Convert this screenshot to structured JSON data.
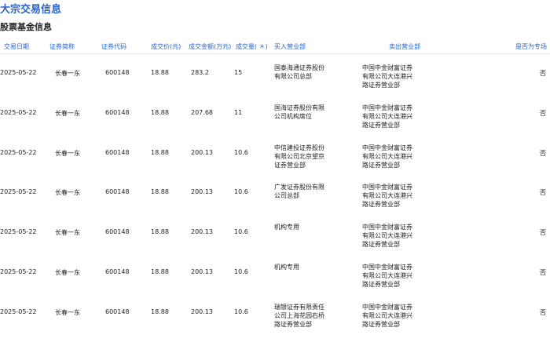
{
  "page": {
    "title": "大宗交易信息",
    "section_title": "股票基金信息"
  },
  "table": {
    "headers": [
      "交易日期",
      "证券简称",
      "证券代码",
      "成交价(元)",
      "成交金额(万元)",
      "成交量( ＊)",
      "买入营业部",
      "卖出营业部",
      "是否为专场"
    ],
    "rows": [
      {
        "date": "2025-05-22",
        "name": "长春一东",
        "code": "600148",
        "price": "18.88",
        "amount": "283.2",
        "volume": "15",
        "buyer": [
          "国泰海通证券股份",
          "有限公司总部"
        ],
        "seller": [
          "中国中金财富证券",
          "有限公司大连港兴",
          "路证券营业部"
        ],
        "special": "否"
      },
      {
        "date": "2025-05-22",
        "name": "长春一东",
        "code": "600148",
        "price": "18.88",
        "amount": "207.68",
        "volume": "11",
        "buyer": [
          "国海证券股份有限",
          "公司机构席位"
        ],
        "seller": [
          "中国中金财富证券",
          "有限公司大连港兴",
          "路证券营业部"
        ],
        "special": "否"
      },
      {
        "date": "2025-05-22",
        "name": "长春一东",
        "code": "600148",
        "price": "18.88",
        "amount": "200.13",
        "volume": "10.6",
        "buyer": [
          "中信建投证券股份",
          "有限公司北京望京",
          "证券营业部"
        ],
        "seller": [
          "中国中金财富证券",
          "有限公司大连港兴",
          "路证券营业部"
        ],
        "special": "否"
      },
      {
        "date": "2025-05-22",
        "name": "长春一东",
        "code": "600148",
        "price": "18.88",
        "amount": "200.13",
        "volume": "10.6",
        "buyer": [
          "广发证券股份有限",
          "公司总部"
        ],
        "seller": [
          "中国中金财富证券",
          "有限公司大连港兴",
          "路证券营业部"
        ],
        "special": "否"
      },
      {
        "date": "2025-05-22",
        "name": "长春一东",
        "code": "600148",
        "price": "18.88",
        "amount": "200.13",
        "volume": "10.6",
        "buyer": [
          "机构专用"
        ],
        "seller": [
          "中国中金财富证券",
          "有限公司大连港兴",
          "路证券营业部"
        ],
        "special": "否"
      },
      {
        "date": "2025-05-22",
        "name": "长春一东",
        "code": "600148",
        "price": "18.88",
        "amount": "200.13",
        "volume": "10.6",
        "buyer": [
          "机构专用"
        ],
        "seller": [
          "中国中金财富证券",
          "有限公司大连港兴",
          "路证券营业部"
        ],
        "special": "否"
      },
      {
        "date": "2025-05-22",
        "name": "长春一东",
        "code": "600148",
        "price": "18.88",
        "amount": "200.13",
        "volume": "10.6",
        "buyer": [
          "瑞银证券有限责任",
          "公司上海花园石桥",
          "路证券营业部"
        ],
        "seller": [
          "中国中金财富证券",
          "有限公司大连港兴",
          "路证券营业部"
        ],
        "special": "否"
      }
    ]
  },
  "colors": {
    "accent": "#2a63c9",
    "text": "#222222",
    "divider": "#e6e6e6"
  }
}
